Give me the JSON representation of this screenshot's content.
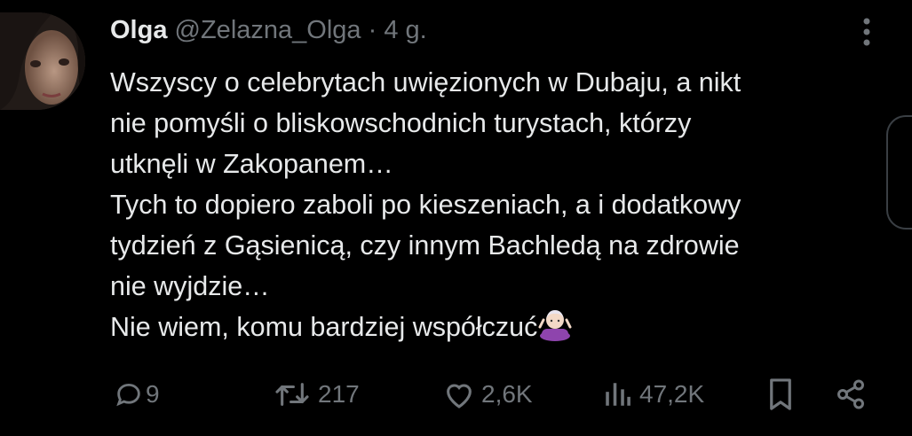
{
  "tweet": {
    "author": {
      "name": "Olga",
      "handle": "@Zelazna_Olga",
      "separator": "·",
      "time": "4 g."
    },
    "lines": [
      "Wszyscy o celebrytach uwięzionych w Dubaju, a nikt",
      "nie pomyśli o bliskowschodnich turystach, którzy",
      "utknęli w Zakopanem…",
      "Tych to dopiero zaboli po kieszeniach, a i dodatkowy",
      "tydzień z Gąsienicą, czy innym Bachledą na zdrowie",
      "nie wyjdzie…",
      "Nie wiem, komu bardziej współczuć"
    ],
    "emoji": "🤷🏻‍♀️",
    "stats": {
      "replies": "9",
      "reposts": "217",
      "likes": "2,6K",
      "views": "47,2K"
    }
  },
  "icons": [
    "avatar",
    "more-icon",
    "reply-icon",
    "repost-icon",
    "like-icon",
    "views-icon",
    "bookmark-icon",
    "share-icon",
    "shrug-emoji"
  ],
  "colors": {
    "background": "#000000",
    "text": "#e7e9ea",
    "muted": "#71767b",
    "emoji": "#8e44ad"
  }
}
